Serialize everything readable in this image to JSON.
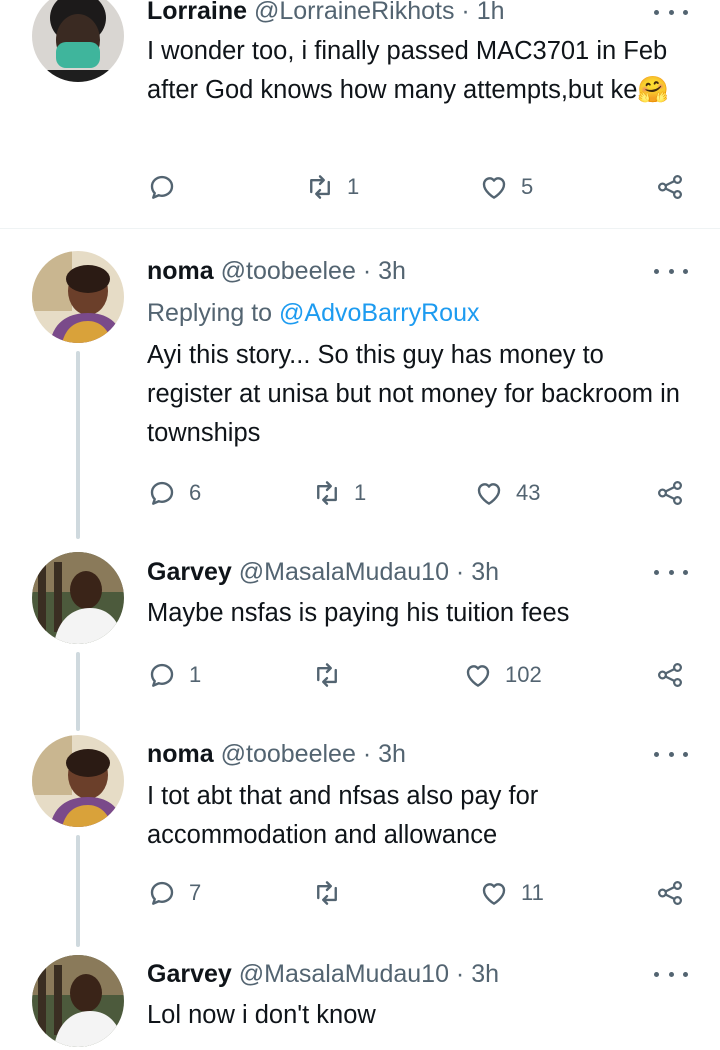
{
  "colors": {
    "text": "#0f1419",
    "secondary": "#536471",
    "link": "#1d9bf0",
    "thread": "#cfd9de"
  },
  "tweets": [
    {
      "name": "Lorraine",
      "handle": "@LorraineRikhots",
      "dot": "·",
      "time": "1h",
      "reply_to_prefix": "",
      "reply_to_mention": "",
      "text": "I wonder too, i finally passed MAC3701 in Feb after God knows how many attempts,but ke🤗",
      "replies": "",
      "retweets": "1",
      "likes": "5"
    },
    {
      "name": "noma",
      "handle": "@toobeelee",
      "dot": "·",
      "time": "3h",
      "reply_to_prefix": "Replying to",
      "reply_to_mention": "@AdvoBarryRoux",
      "text": "Ayi this story... So this guy has money to register at unisa but not money for backroom in townships",
      "replies": "6",
      "retweets": "1",
      "likes": "43"
    },
    {
      "name": "Garvey",
      "handle": "@MasalaMudau10",
      "dot": "·",
      "time": "3h",
      "text": "Maybe nsfas is paying his tuition fees",
      "replies": "1",
      "retweets": "",
      "likes": "102"
    },
    {
      "name": "noma",
      "handle": "@toobeelee",
      "dot": "·",
      "time": "3h",
      "text": "I tot abt that and nfsas also pay for accommodation and allowance",
      "replies": "7",
      "retweets": "",
      "likes": "11"
    },
    {
      "name": "Garvey",
      "handle": "@MasalaMudau10",
      "dot": "·",
      "time": "3h",
      "text": "Lol now i don't know"
    }
  ]
}
